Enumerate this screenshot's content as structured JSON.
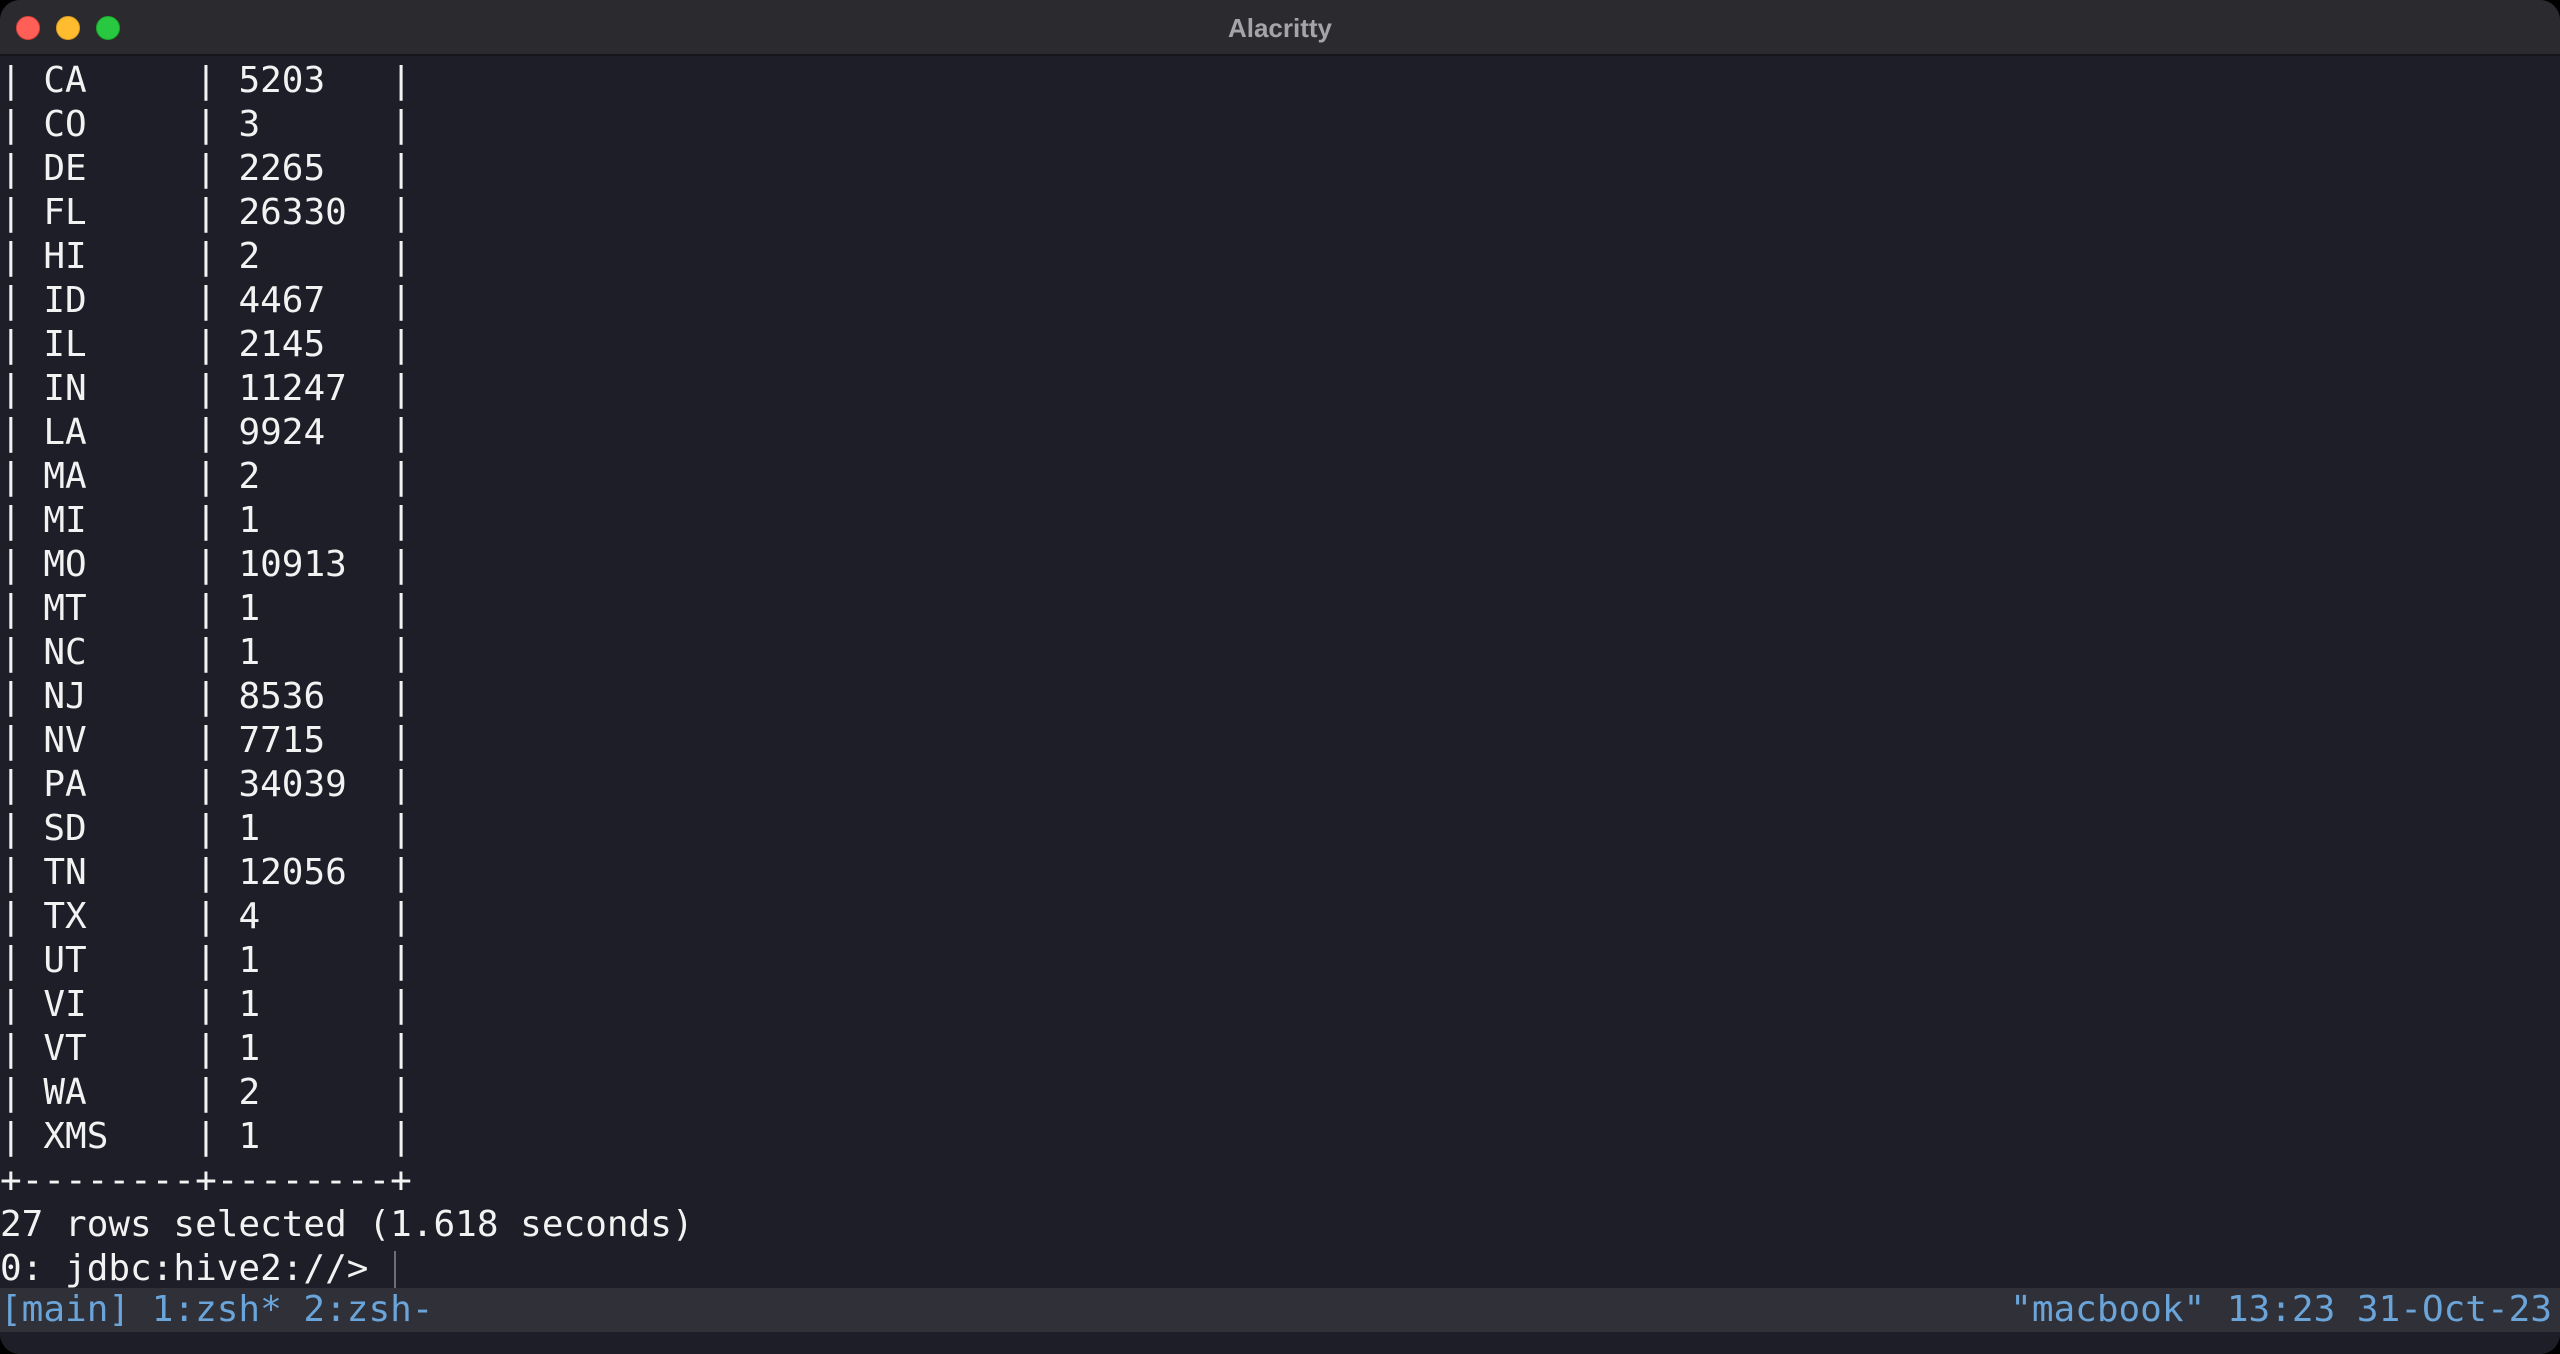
{
  "window": {
    "title": "Alacritty"
  },
  "terminal": {
    "rows": [
      {
        "state": "CA",
        "count": "5203"
      },
      {
        "state": "CO",
        "count": "3"
      },
      {
        "state": "DE",
        "count": "2265"
      },
      {
        "state": "FL",
        "count": "26330"
      },
      {
        "state": "HI",
        "count": "2"
      },
      {
        "state": "ID",
        "count": "4467"
      },
      {
        "state": "IL",
        "count": "2145"
      },
      {
        "state": "IN",
        "count": "11247"
      },
      {
        "state": "LA",
        "count": "9924"
      },
      {
        "state": "MA",
        "count": "2"
      },
      {
        "state": "MI",
        "count": "1"
      },
      {
        "state": "MO",
        "count": "10913"
      },
      {
        "state": "MT",
        "count": "1"
      },
      {
        "state": "NC",
        "count": "1"
      },
      {
        "state": "NJ",
        "count": "8536"
      },
      {
        "state": "NV",
        "count": "7715"
      },
      {
        "state": "PA",
        "count": "34039"
      },
      {
        "state": "SD",
        "count": "1"
      },
      {
        "state": "TN",
        "count": "12056"
      },
      {
        "state": "TX",
        "count": "4"
      },
      {
        "state": "UT",
        "count": "1"
      },
      {
        "state": "VI",
        "count": "1"
      },
      {
        "state": "VT",
        "count": "1"
      },
      {
        "state": "WA",
        "count": "2"
      },
      {
        "state": "XMS",
        "count": "1"
      }
    ],
    "table_border": "+--------+--------+",
    "summary": "27 rows selected (1.618 seconds)",
    "prompt": "0: jdbc:hive2://> "
  },
  "statusbar": {
    "session": "[main] 1:zsh* 2:zsh-",
    "right": "\"macbook\" 13:23 31-Oct-23"
  },
  "colors": {
    "background": "#1e1e28",
    "foreground": "#f2f2f2",
    "statusbar_bg": "#303038",
    "statusbar_fg": "#6aa4d8"
  }
}
